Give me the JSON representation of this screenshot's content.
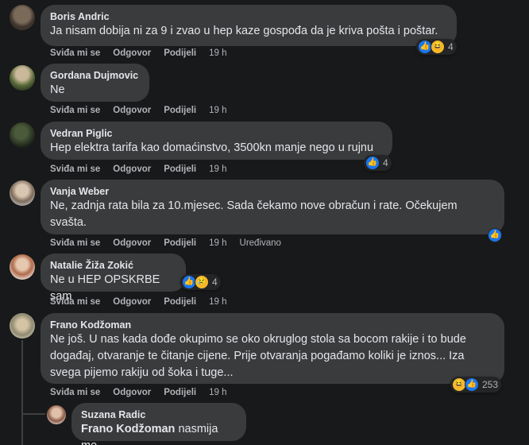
{
  "actions": {
    "like": "Sviđa mi se",
    "reply": "Odgovor",
    "share": "Podijeli"
  },
  "comments": [
    {
      "author": "Boris Andric",
      "text": "Ja nisam dobija ni za 9 i zvao u hep kaze gospođa da je kriva pošta i poštar.",
      "time": "19 h",
      "reaction_count": "4",
      "reactions": [
        "like-icon",
        "haha-icon"
      ]
    },
    {
      "author": "Gordana Dujmovic",
      "text": "Ne",
      "time": "19 h"
    },
    {
      "author": "Vedran Piglic",
      "text": "Hep elektra tarifa kao domaćinstvo, 3500kn manje nego u rujnu",
      "time": "19 h",
      "reaction_count": "4",
      "reactions": [
        "like-icon"
      ]
    },
    {
      "author": "Vanja Weber",
      "text_lines": [
        "Ne, zadnja rata bila za 10.mjesec. Sada čekamo nove obračun i rate. Očekujem",
        "svašta."
      ],
      "time": "19 h",
      "edited": "Uređivano",
      "reactions": [
        "like-icon"
      ]
    },
    {
      "author": "Natalie Žiža Zokić",
      "text": "Ne u HEP OPSKRBE sam",
      "time": "19 h",
      "reaction_count": "4",
      "reactions": [
        "like-icon",
        "sad-icon"
      ]
    },
    {
      "author": "Frano Kodžoman",
      "text_lines": [
        "Ne još. U nas kada dođe okupimo se oko okruglog stola sa bocom rakije i to bude",
        "događaj, otvaranje te čitanje cijene. Prije otvaranja pogađamo koliki je iznos... Iza",
        "svega pijemo rakiju od šoka i tuge..."
      ],
      "time": "19 h",
      "reaction_count": "253",
      "reactions": [
        "haha-icon",
        "like-icon"
      ]
    },
    {
      "author": "Suzana Radic",
      "mention": "Frano Kodžoman",
      "text": "nasmija me"
    }
  ],
  "colors": {
    "background": "#18191a",
    "bubble": "#3a3b3c",
    "like": "#1877f2",
    "emoji": "#f7b928"
  }
}
